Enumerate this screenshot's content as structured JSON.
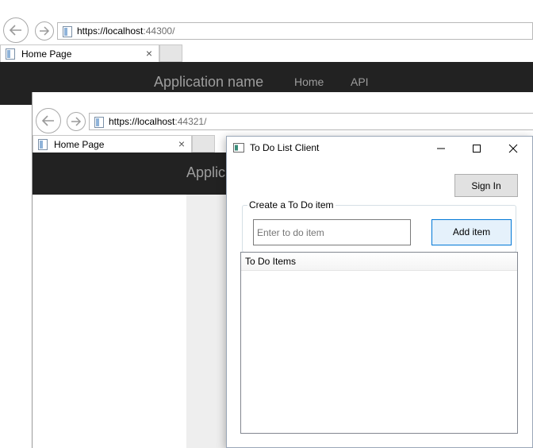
{
  "browser_back": {
    "url_host": "https://localhost",
    "url_port": ":44300/",
    "tab_title": "Home Page",
    "tab_close": "×",
    "nav": {
      "brand": "Application name",
      "links": [
        "Home",
        "API"
      ]
    }
  },
  "browser_front": {
    "url_host": "https://localhost",
    "url_port": ":44321/",
    "tab_title": "Home Page",
    "tab_close": "×",
    "nav": {
      "brand_partial": "Applic"
    }
  },
  "window": {
    "title": "To Do List Client",
    "minimize": "—",
    "maximize": "☐",
    "close": "✕",
    "sign_in_label": "Sign In",
    "group_label": "Create a To Do item",
    "todo_input": {
      "value": "",
      "placeholder": "Enter to do item"
    },
    "add_label": "Add item",
    "list_header": "To Do Items",
    "items": []
  },
  "colors": {
    "navbar_bg": "#222222",
    "nav_text": "#9d9d9d",
    "focus_blue": "#0078d7"
  }
}
